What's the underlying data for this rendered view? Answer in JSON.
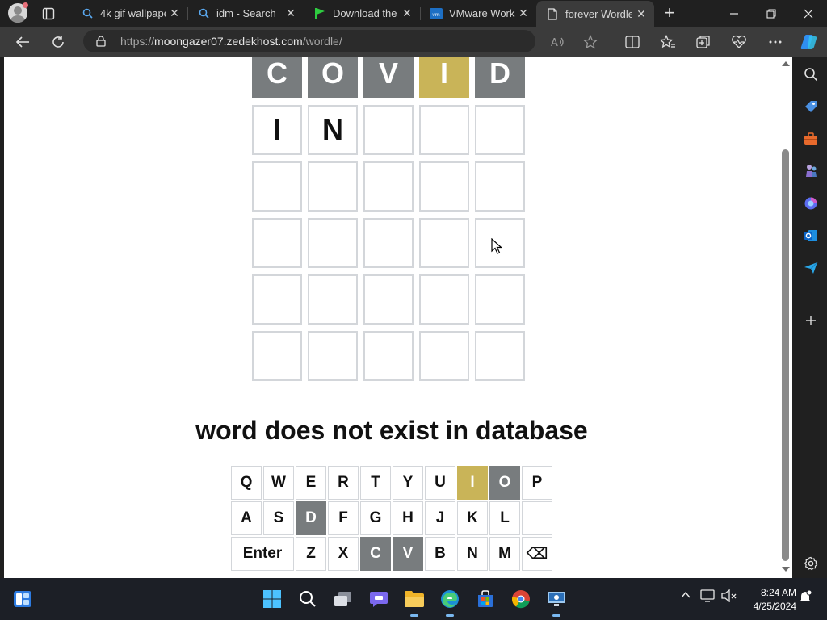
{
  "browser": {
    "tabs": [
      {
        "label": "4k gif wallpape",
        "favicon": "search-icon"
      },
      {
        "label": "idm - Search",
        "favicon": "search-icon"
      },
      {
        "label": "Download the",
        "favicon": "flag-icon"
      },
      {
        "label": "VMware Works",
        "favicon": "vmware-icon"
      },
      {
        "label": "forever Wordle",
        "favicon": "page-icon",
        "active": true
      }
    ],
    "url_prefix": "https://",
    "url_host": "moongazer07.zedekhost.com",
    "url_path": "/wordle/"
  },
  "game": {
    "board": [
      [
        {
          "letter": "C",
          "state": "gray"
        },
        {
          "letter": "O",
          "state": "gray"
        },
        {
          "letter": "V",
          "state": "gray"
        },
        {
          "letter": "I",
          "state": "yellow"
        },
        {
          "letter": "D",
          "state": "gray"
        }
      ],
      [
        {
          "letter": "I",
          "state": "empty"
        },
        {
          "letter": "N",
          "state": "empty"
        },
        {
          "letter": "",
          "state": "empty"
        },
        {
          "letter": "",
          "state": "empty"
        },
        {
          "letter": "",
          "state": "empty"
        }
      ],
      [
        {
          "letter": "",
          "state": "empty"
        },
        {
          "letter": "",
          "state": "empty"
        },
        {
          "letter": "",
          "state": "empty"
        },
        {
          "letter": "",
          "state": "empty"
        },
        {
          "letter": "",
          "state": "empty"
        }
      ],
      [
        {
          "letter": "",
          "state": "empty"
        },
        {
          "letter": "",
          "state": "empty"
        },
        {
          "letter": "",
          "state": "empty"
        },
        {
          "letter": "",
          "state": "empty"
        },
        {
          "letter": "",
          "state": "empty"
        }
      ],
      [
        {
          "letter": "",
          "state": "empty"
        },
        {
          "letter": "",
          "state": "empty"
        },
        {
          "letter": "",
          "state": "empty"
        },
        {
          "letter": "",
          "state": "empty"
        },
        {
          "letter": "",
          "state": "empty"
        }
      ],
      [
        {
          "letter": "",
          "state": "empty"
        },
        {
          "letter": "",
          "state": "empty"
        },
        {
          "letter": "",
          "state": "empty"
        },
        {
          "letter": "",
          "state": "empty"
        },
        {
          "letter": "",
          "state": "empty"
        }
      ]
    ],
    "message": "word does not exist in database",
    "keyboard": [
      [
        {
          "label": "Q",
          "state": "none"
        },
        {
          "label": "W",
          "state": "none"
        },
        {
          "label": "E",
          "state": "none"
        },
        {
          "label": "R",
          "state": "none"
        },
        {
          "label": "T",
          "state": "none"
        },
        {
          "label": "Y",
          "state": "none"
        },
        {
          "label": "U",
          "state": "none"
        },
        {
          "label": "I",
          "state": "yellow"
        },
        {
          "label": "O",
          "state": "gray"
        },
        {
          "label": "P",
          "state": "none"
        }
      ],
      [
        {
          "label": "A",
          "state": "none"
        },
        {
          "label": "S",
          "state": "none"
        },
        {
          "label": "D",
          "state": "gray"
        },
        {
          "label": "F",
          "state": "none"
        },
        {
          "label": "G",
          "state": "none"
        },
        {
          "label": "H",
          "state": "none"
        },
        {
          "label": "J",
          "state": "none"
        },
        {
          "label": "K",
          "state": "none"
        },
        {
          "label": "L",
          "state": "none"
        },
        {
          "label": "",
          "state": "none"
        }
      ],
      [
        {
          "label": "Enter",
          "state": "none",
          "wide": true
        },
        {
          "label": "Z",
          "state": "none"
        },
        {
          "label": "X",
          "state": "none"
        },
        {
          "label": "C",
          "state": "gray"
        },
        {
          "label": "V",
          "state": "gray"
        },
        {
          "label": "B",
          "state": "none"
        },
        {
          "label": "N",
          "state": "none"
        },
        {
          "label": "M",
          "state": "none"
        },
        {
          "label": "⌫",
          "state": "none"
        }
      ]
    ],
    "colors": {
      "gray": "#787c7e",
      "yellow": "#c9b458",
      "border": "#d3d6da"
    }
  },
  "taskbar": {
    "time": "8:24 AM",
    "date": "4/25/2024"
  }
}
